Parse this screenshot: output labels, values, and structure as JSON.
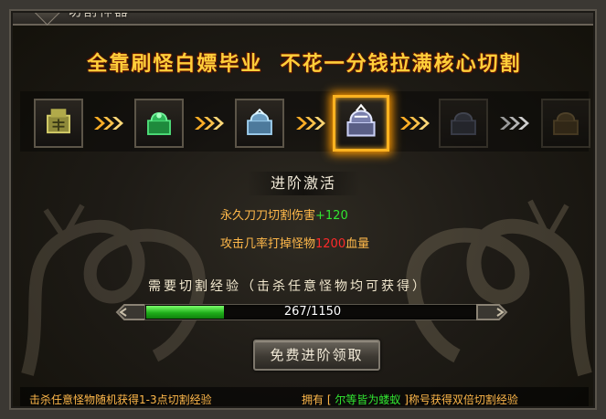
{
  "window": {
    "title": "切割神器"
  },
  "banner": {
    "text": "全靠刷怪白嫖毕业  不花一分钱拉满核心切割"
  },
  "stages": [
    {
      "icon": "jade-seal-icon",
      "state": "unlocked"
    },
    {
      "icon": "green-seal-icon",
      "state": "unlocked"
    },
    {
      "icon": "blue-seal-icon",
      "state": "unlocked"
    },
    {
      "icon": "silver-seal-icon",
      "state": "current"
    },
    {
      "icon": "dark-seal-icon",
      "state": "locked"
    },
    {
      "icon": "bronze-seal-icon",
      "state": "locked"
    }
  ],
  "advance": {
    "title": "进阶激活",
    "attr1_prefix": "永久刀刀切割伤害",
    "attr1_value": "+120",
    "attr2_prefix": "攻击几率打掉怪物",
    "attr2_value": "1200",
    "attr2_suffix": "血量"
  },
  "requirement": {
    "label": "需要切割经验（击杀任意怪物均可获得）",
    "current": 267,
    "max": 1150,
    "progress_text": "267/1150"
  },
  "claim_button": {
    "label": "免费进阶领取"
  },
  "footer": {
    "left": "击杀任意怪物随机获得1-3点切割经验",
    "right_prefix": "拥有",
    "bracket_open": "[",
    "title_name": "尔等皆为蝼蚁",
    "bracket_close": "]",
    "right_suffix": "称号获得双倍切割经验"
  },
  "colors": {
    "accent": "#ffb320",
    "banner": "#ffcf3a",
    "positive": "#31e631",
    "negative": "#ff2a2a",
    "text": "#ffb84a"
  }
}
